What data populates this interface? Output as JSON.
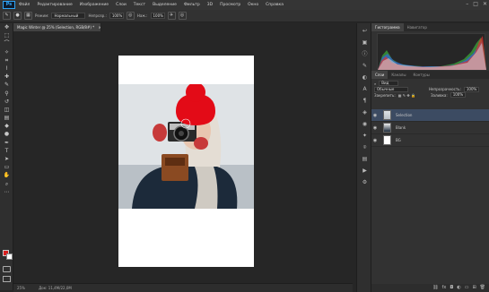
{
  "app": {
    "logo": "Ps"
  },
  "menu": [
    "Файл",
    "Редактирование",
    "Изображение",
    "Слои",
    "Текст",
    "Выделение",
    "Фильтр",
    "3D",
    "Просмотр",
    "Окно",
    "Справка"
  ],
  "window_controls": [
    "–",
    "□",
    "✕"
  ],
  "options": {
    "mode_label": "Режим:",
    "mode_value": "Нормальный",
    "opacity_label": "Непрозр.:",
    "opacity_value": "100%",
    "flow_label": "Наж.:",
    "flow_value": "100%"
  },
  "document": {
    "tab_title": "Magic Winter @ 25% (Selection, RGB/8#) *",
    "close_glyph": "×"
  },
  "status": {
    "zoom": "25%",
    "doc_info": "Док: 11,4М/22,0М"
  },
  "panels": {
    "top_tabs": [
      "Гистограмма",
      "Навигатор"
    ],
    "layers_tabs": [
      "Слои",
      "Каналы",
      "Контуры"
    ],
    "filter_label": "Вид",
    "blend_mode": "Обычные",
    "opacity_label": "Непрозрачность:",
    "opacity_value": "100%",
    "lock_label": "Закрепить:",
    "fill_label": "Заливка:",
    "fill_value": "100%",
    "layers": [
      {
        "name": "Selection",
        "selected": true
      },
      {
        "name": "Blank",
        "selected": false
      },
      {
        "name": "BG",
        "selected": false
      }
    ]
  },
  "colors": {
    "foreground": "#d81e1e",
    "background": "#ffffff",
    "selected_layer": "#3c4b62",
    "hat": "#e30b17"
  }
}
